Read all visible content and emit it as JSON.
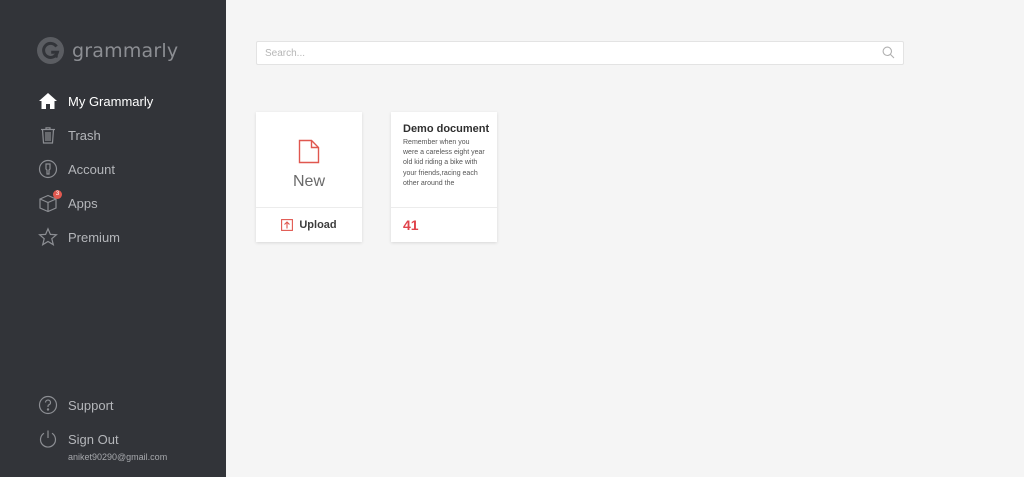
{
  "brand": {
    "name": "grammarly",
    "logo_icon": "grammarly-g-icon"
  },
  "sidebar": {
    "items": [
      {
        "label": "My Grammarly",
        "icon": "home-icon",
        "active": true
      },
      {
        "label": "Trash",
        "icon": "trash-icon"
      },
      {
        "label": "Account",
        "icon": "account-icon"
      },
      {
        "label": "Apps",
        "icon": "apps-box-icon",
        "badge": "3"
      },
      {
        "label": "Premium",
        "icon": "star-icon"
      }
    ],
    "bottom_items": [
      {
        "label": "Support",
        "icon": "help-icon"
      },
      {
        "label": "Sign Out",
        "icon": "power-icon"
      }
    ],
    "email": "aniket90290@gmail.com"
  },
  "search": {
    "placeholder": "Search...",
    "value": "",
    "icon": "search-icon"
  },
  "new_card": {
    "label": "New",
    "icon": "new-document-icon",
    "upload_label": "Upload",
    "upload_icon": "upload-icon"
  },
  "documents": [
    {
      "title": "Demo document",
      "excerpt": "Remember when you were a careless eight year old kid riding a bike with your friends,racing each other around the",
      "score": "41"
    }
  ],
  "colors": {
    "sidebar_bg": "#323439",
    "accent_red": "#e0434b",
    "page_bg": "#f5f5f5"
  }
}
